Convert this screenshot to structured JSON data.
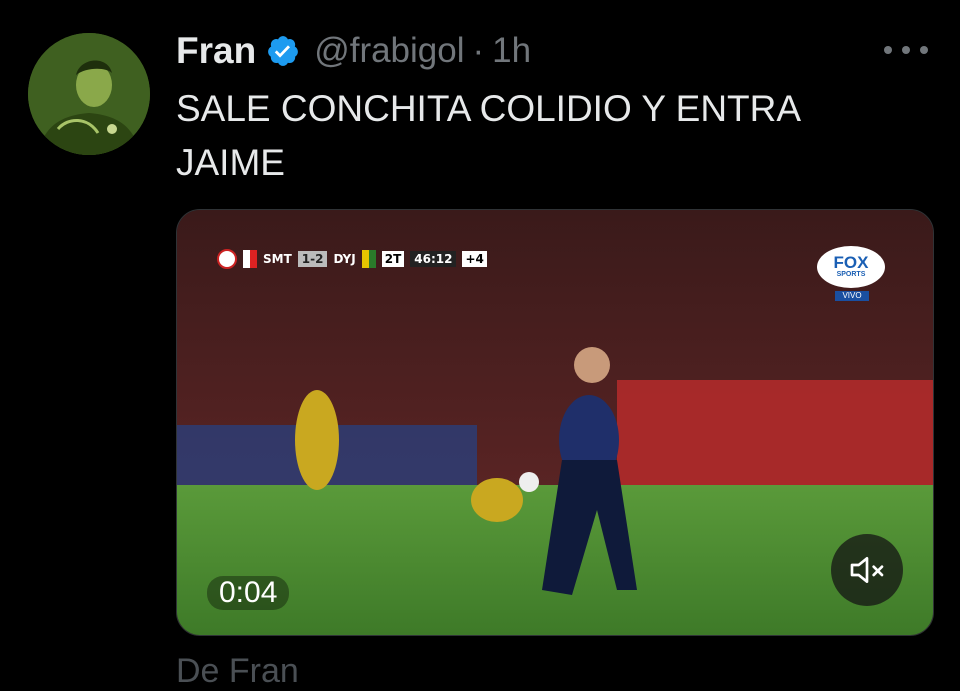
{
  "tweet": {
    "author": {
      "name": "Fran",
      "handle": "@frabigol",
      "verified": true,
      "avatar_icon": "profile-avatar"
    },
    "separator": "·",
    "timestamp": "1h",
    "text": "SALE CONCHITA COLIDIO Y ENTRA JAIME",
    "more_icon": "more-horizontal-icon"
  },
  "media": {
    "type": "video",
    "duration": "0:04",
    "mute_icon": "speaker-muted-icon",
    "scorebug": {
      "home": "SMT",
      "score": "1-2",
      "away": "DYJ",
      "half": "2T",
      "clock": "46:12",
      "added": "+4"
    },
    "broadcaster": {
      "name": "FOX",
      "sub": "SPORTS",
      "live": "VIVO"
    }
  },
  "footer_text": "De Fran",
  "colors": {
    "background": "#000000",
    "text": "#e7e9ea",
    "secondary": "#71767b",
    "verified": "#1d9bf0"
  }
}
